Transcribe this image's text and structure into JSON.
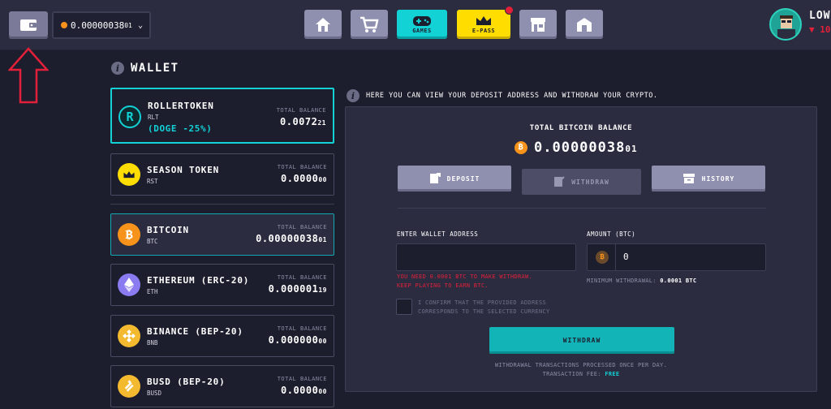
{
  "header": {
    "balance_value": "0.00000038",
    "balance_small": "01",
    "nav": [
      {
        "name": "home",
        "label": ""
      },
      {
        "name": "marketplace",
        "label": ""
      },
      {
        "name": "games",
        "label": "GAMES"
      },
      {
        "name": "epass",
        "label": "E-PASS"
      },
      {
        "name": "store",
        "label": ""
      },
      {
        "name": "hall",
        "label": ""
      }
    ],
    "username": "LOW",
    "level": "▼ 10"
  },
  "wallet": {
    "title": "WALLET",
    "total_balance_label": "TOTAL BALANCE",
    "currencies": [
      {
        "name": "ROLLERTOKEN",
        "code": "RLT",
        "promo": "(DOGE -25%)",
        "balance": "0.0072",
        "balance_small": "21",
        "icon": "rollertoken-icon",
        "color": "#0f2a2e"
      },
      {
        "name": "SEASON TOKEN",
        "code": "RST",
        "balance": "0.0000",
        "balance_small": "00",
        "icon": "crown-icon",
        "color": "#ffdd00"
      },
      {
        "name": "BITCOIN",
        "code": "BTC",
        "balance": "0.00000038",
        "balance_small": "01",
        "icon": "bitcoin-icon",
        "color": "#f7931a"
      },
      {
        "name": "ETHEREUM (ERC-20)",
        "code": "ETH",
        "balance": "0.000001",
        "balance_small": "19",
        "icon": "ethereum-icon",
        "color": "#8a7bf0"
      },
      {
        "name": "BINANCE (BEP-20)",
        "code": "BNB",
        "balance": "0.000000",
        "balance_small": "00",
        "icon": "binance-icon",
        "color": "#f3ba2f"
      },
      {
        "name": "BUSD (BEP-20)",
        "code": "BUSD",
        "balance": "0.0000",
        "balance_small": "00",
        "icon": "busd-icon",
        "color": "#f3ba2f"
      }
    ]
  },
  "panel": {
    "note": "HERE YOU CAN VIEW YOUR DEPOSIT ADDRESS AND WITHDRAW YOUR CRYPTO.",
    "total_label": "TOTAL BITCOIN BALANCE",
    "total_value": "0.00000038",
    "total_small": "01",
    "tabs": {
      "deposit": "DEPOSIT",
      "withdraw": "WITHDRAW",
      "history": "HISTORY"
    },
    "address_label": "ENTER WALLET ADDRESS",
    "amount_label": "AMOUNT (BTC)",
    "amount_value": "0",
    "error_line1": "YOU NEED 0.0001 BTC TO MAKE WITHDRAW.",
    "error_line2": "KEEP PLAYING TO EARN BTC.",
    "min_label": "MINIMUM WITHDRAWAL:",
    "min_value": "0.0001 BTC",
    "confirm_line1": "I CONFIRM THAT THE PROVIDED ADDRESS",
    "confirm_line2": "CORRESPONDS TO THE SELECTED CURRENCY",
    "withdraw_button": "WITHDRAW",
    "footnote1": "WITHDRAWAL TRANSACTIONS PROCESSED ONCE PER DAY.",
    "footnote2": "TRANSACTION FEE:",
    "fee": "FREE"
  }
}
